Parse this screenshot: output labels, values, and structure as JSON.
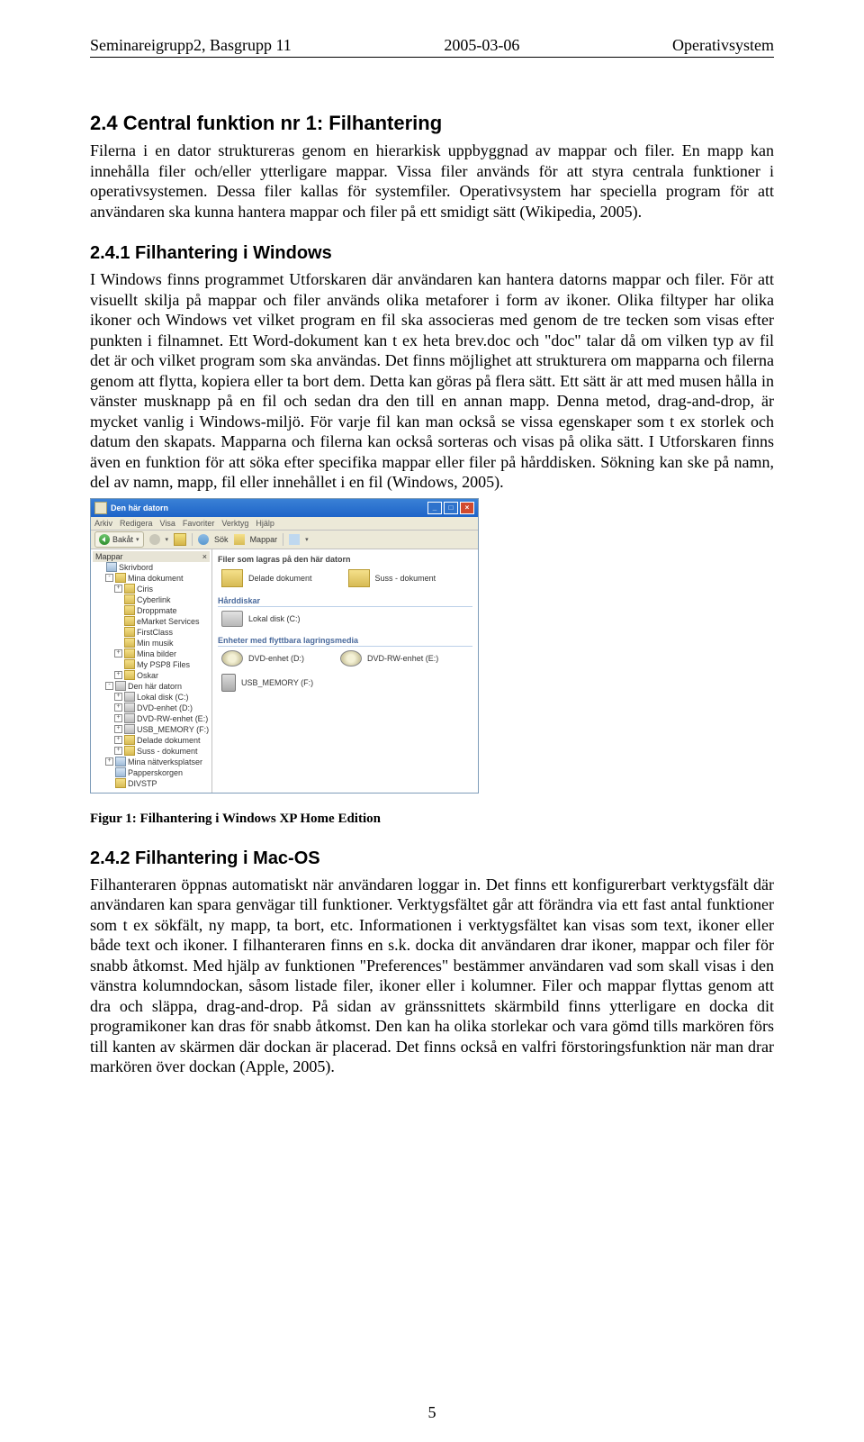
{
  "header": {
    "left": "Seminareigrupp2, Basgrupp 11",
    "middle": "2005-03-06",
    "right": "Operativsystem"
  },
  "section24": {
    "title": "2.4  Central funktion nr 1: Filhantering",
    "p1": "Filerna i en dator struktureras genom en hierarkisk uppbyggnad av mappar och filer. En mapp kan innehålla filer och/eller ytterligare mappar. Vissa filer används för att styra centrala funktioner i operativsystemen. Dessa filer kallas för systemfiler. Operativsystem har speciella program för att användaren ska kunna hantera mappar och filer på ett smidigt sätt (Wikipedia, 2005)."
  },
  "section241": {
    "title": "2.4.1  Filhantering i Windows",
    "p1": "I Windows finns programmet Utforskaren där användaren kan hantera datorns mappar och filer. För att visuellt skilja på mappar och filer används olika metaforer i form av ikoner. Olika filtyper har olika ikoner och Windows vet vilket program en fil ska associeras med genom de tre tecken som visas efter punkten i filnamnet. Ett Word-dokument kan t ex heta brev.doc och \"doc\" talar då om vilken typ av fil det är och vilket program som ska användas. Det finns möjlighet att strukturera om mapparna och filerna genom att flytta, kopiera eller ta bort dem. Detta kan göras på flera sätt. Ett sätt är att med musen hålla in vänster musknapp på en fil och sedan dra den till en annan mapp. Denna metod, drag-and-drop, är mycket vanlig i Windows-miljö. För varje fil kan man också se vissa egenskaper som t ex storlek och datum den skapats. Mapparna och filerna kan också sorteras och visas på olika sätt. I Utforskaren finns även en funktion för att söka efter specifika mappar eller filer på hårddisken. Sökning kan ske på namn, del av namn, mapp, fil eller innehållet i en fil (Windows, 2005)."
  },
  "figure1": {
    "caption": "Figur 1: Filhantering i Windows XP Home Edition",
    "window_title": "Den här datorn",
    "menu": [
      "Arkiv",
      "Redigera",
      "Visa",
      "Favoriter",
      "Verktyg",
      "Hjälp"
    ],
    "toolbar": {
      "back": "Bakåt",
      "search": "Sök",
      "folders": "Mappar"
    },
    "tree": {
      "header": "Mappar",
      "close": "×",
      "nodes": [
        {
          "lvl": 0,
          "box": "",
          "icon": "dicon",
          "label": "Skrivbord"
        },
        {
          "lvl": 1,
          "box": "-",
          "icon": "ficon",
          "label": "Mina dokument"
        },
        {
          "lvl": 2,
          "box": "+",
          "icon": "ficon",
          "label": "Ciris"
        },
        {
          "lvl": 2,
          "box": "",
          "icon": "ficon",
          "label": "Cyberlink"
        },
        {
          "lvl": 2,
          "box": "",
          "icon": "ficon",
          "label": "Droppmate"
        },
        {
          "lvl": 2,
          "box": "",
          "icon": "ficon",
          "label": "eMarket Services"
        },
        {
          "lvl": 2,
          "box": "",
          "icon": "ficon",
          "label": "FirstClass"
        },
        {
          "lvl": 2,
          "box": "",
          "icon": "ficon",
          "label": "Min musik"
        },
        {
          "lvl": 2,
          "box": "+",
          "icon": "ficon",
          "label": "Mina bilder"
        },
        {
          "lvl": 2,
          "box": "",
          "icon": "ficon",
          "label": "My PSP8 Files"
        },
        {
          "lvl": 2,
          "box": "+",
          "icon": "ficon",
          "label": "Oskar"
        },
        {
          "lvl": 1,
          "box": "-",
          "icon": "cicon",
          "label": "Den här datorn"
        },
        {
          "lvl": 2,
          "box": "+",
          "icon": "cicon",
          "label": "Lokal disk (C:)"
        },
        {
          "lvl": 2,
          "box": "+",
          "icon": "cicon",
          "label": "DVD-enhet (D:)"
        },
        {
          "lvl": 2,
          "box": "+",
          "icon": "cicon",
          "label": "DVD-RW-enhet (E:)"
        },
        {
          "lvl": 2,
          "box": "+",
          "icon": "cicon",
          "label": "USB_MEMORY (F:)"
        },
        {
          "lvl": 2,
          "box": "+",
          "icon": "ficon",
          "label": "Delade dokument"
        },
        {
          "lvl": 2,
          "box": "+",
          "icon": "ficon",
          "label": "Suss - dokument"
        },
        {
          "lvl": 1,
          "box": "+",
          "icon": "dicon",
          "label": "Mina nätverksplatser"
        },
        {
          "lvl": 1,
          "box": "",
          "icon": "dicon",
          "label": "Papperskorgen"
        },
        {
          "lvl": 1,
          "box": "",
          "icon": "ficon",
          "label": "DIVSTP"
        }
      ]
    },
    "main": {
      "hint": "Filer som lagras på den här datorn",
      "folders_row": [
        {
          "label": "Delade dokument"
        },
        {
          "label": "Suss - dokument"
        }
      ],
      "cat_disks": "Hårddiskar",
      "disks_row": [
        {
          "label": "Lokal disk (C:)"
        }
      ],
      "cat_removable": "Enheter med flyttbara lagringsmedia",
      "removable_row": [
        {
          "label": "DVD-enhet (D:)"
        },
        {
          "label": "DVD-RW-enhet (E:)"
        }
      ],
      "usb_row": [
        {
          "label": "USB_MEMORY (F:)"
        }
      ]
    }
  },
  "section242": {
    "title": "2.4.2  Filhantering i Mac-OS",
    "p1": "Filhanteraren öppnas automatiskt när användaren loggar in. Det finns ett konfigurerbart verktygsfält där användaren kan spara genvägar till funktioner. Verktygsfältet går att förändra via ett fast antal funktioner som t ex sökfält, ny mapp, ta bort, etc. Informationen i verktygsfältet kan visas som text, ikoner eller både text och ikoner. I filhanteraren finns en s.k. docka dit användaren drar ikoner, mappar och filer för snabb åtkomst. Med hjälp av funktionen \"Preferences\" bestämmer användaren vad som skall visas i den vänstra kolumndockan, såsom listade filer, ikoner eller i kolumner. Filer och mappar flyttas genom att dra och släppa, drag-and-drop. På sidan av gränssnittets skärmbild finns ytterligare en docka dit programikoner kan dras för snabb åtkomst. Den kan ha olika storlekar och vara gömd tills markören förs till kanten av skärmen där dockan är placerad. Det finns också en valfri förstoringsfunktion när man drar markören över dockan (Apple, 2005)."
  },
  "page_number": "5"
}
